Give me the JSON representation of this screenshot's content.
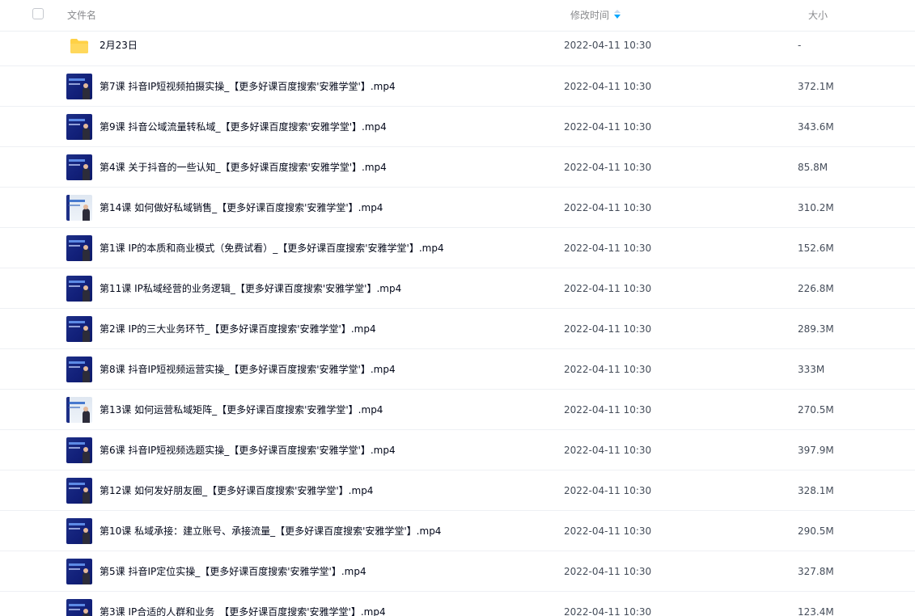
{
  "header": {
    "col_name": "文件名",
    "col_modified": "修改时间",
    "col_size": "大小",
    "sort_icon": "sort-descending-icon"
  },
  "colors": {
    "accent": "#06a7ff",
    "header_text": "#898a8d",
    "row_text": "#03081a",
    "folder": "#ffd145"
  },
  "files": [
    {
      "name": "2月23日",
      "modified": "2022-04-11 10:30",
      "size": "-",
      "type": "folder"
    },
    {
      "name": "第7课 抖音IP短视频拍摄实操_【更多好课百度搜索'安雅学堂'】.mp4",
      "modified": "2022-04-11 10:30",
      "size": "372.1M",
      "type": "video"
    },
    {
      "name": "第9课 抖音公域流量转私域_【更多好课百度搜索'安雅学堂'】.mp4",
      "modified": "2022-04-11 10:30",
      "size": "343.6M",
      "type": "video"
    },
    {
      "name": "第4课 关于抖音的一些认知_【更多好课百度搜索'安雅学堂'】.mp4",
      "modified": "2022-04-11 10:30",
      "size": "85.8M",
      "type": "video"
    },
    {
      "name": "第14课 如何做好私域销售_【更多好课百度搜索'安雅学堂'】.mp4",
      "modified": "2022-04-11 10:30",
      "size": "310.2M",
      "type": "video-light"
    },
    {
      "name": "第1课 IP的本质和商业模式（免费试看）_【更多好课百度搜索'安雅学堂'】.mp4",
      "modified": "2022-04-11 10:30",
      "size": "152.6M",
      "type": "video"
    },
    {
      "name": "第11课 IP私域经营的业务逻辑_【更多好课百度搜索'安雅学堂'】.mp4",
      "modified": "2022-04-11 10:30",
      "size": "226.8M",
      "type": "video"
    },
    {
      "name": "第2课 IP的三大业务环节_【更多好课百度搜索'安雅学堂'】.mp4",
      "modified": "2022-04-11 10:30",
      "size": "289.3M",
      "type": "video"
    },
    {
      "name": "第8课 抖音IP短视频运营实操_【更多好课百度搜索'安雅学堂'】.mp4",
      "modified": "2022-04-11 10:30",
      "size": "333M",
      "type": "video"
    },
    {
      "name": "第13课 如何运营私域矩阵_【更多好课百度搜索'安雅学堂'】.mp4",
      "modified": "2022-04-11 10:30",
      "size": "270.5M",
      "type": "video-light"
    },
    {
      "name": "第6课 抖音IP短视频选题实操_【更多好课百度搜索'安雅学堂'】.mp4",
      "modified": "2022-04-11 10:30",
      "size": "397.9M",
      "type": "video"
    },
    {
      "name": "第12课 如何发好朋友圈_【更多好课百度搜索'安雅学堂'】.mp4",
      "modified": "2022-04-11 10:30",
      "size": "328.1M",
      "type": "video"
    },
    {
      "name": "第10课 私域承接：建立账号、承接流量_【更多好课百度搜索'安雅学堂'】.mp4",
      "modified": "2022-04-11 10:30",
      "size": "290.5M",
      "type": "video"
    },
    {
      "name": "第5课 抖音IP定位实操_【更多好课百度搜索'安雅学堂'】.mp4",
      "modified": "2022-04-11 10:30",
      "size": "327.8M",
      "type": "video"
    },
    {
      "name": "第3课 IP合适的人群和业务_【更多好课百度搜索'安雅学堂'】.mp4",
      "modified": "2022-04-11 10:30",
      "size": "123.4M",
      "type": "video"
    }
  ]
}
